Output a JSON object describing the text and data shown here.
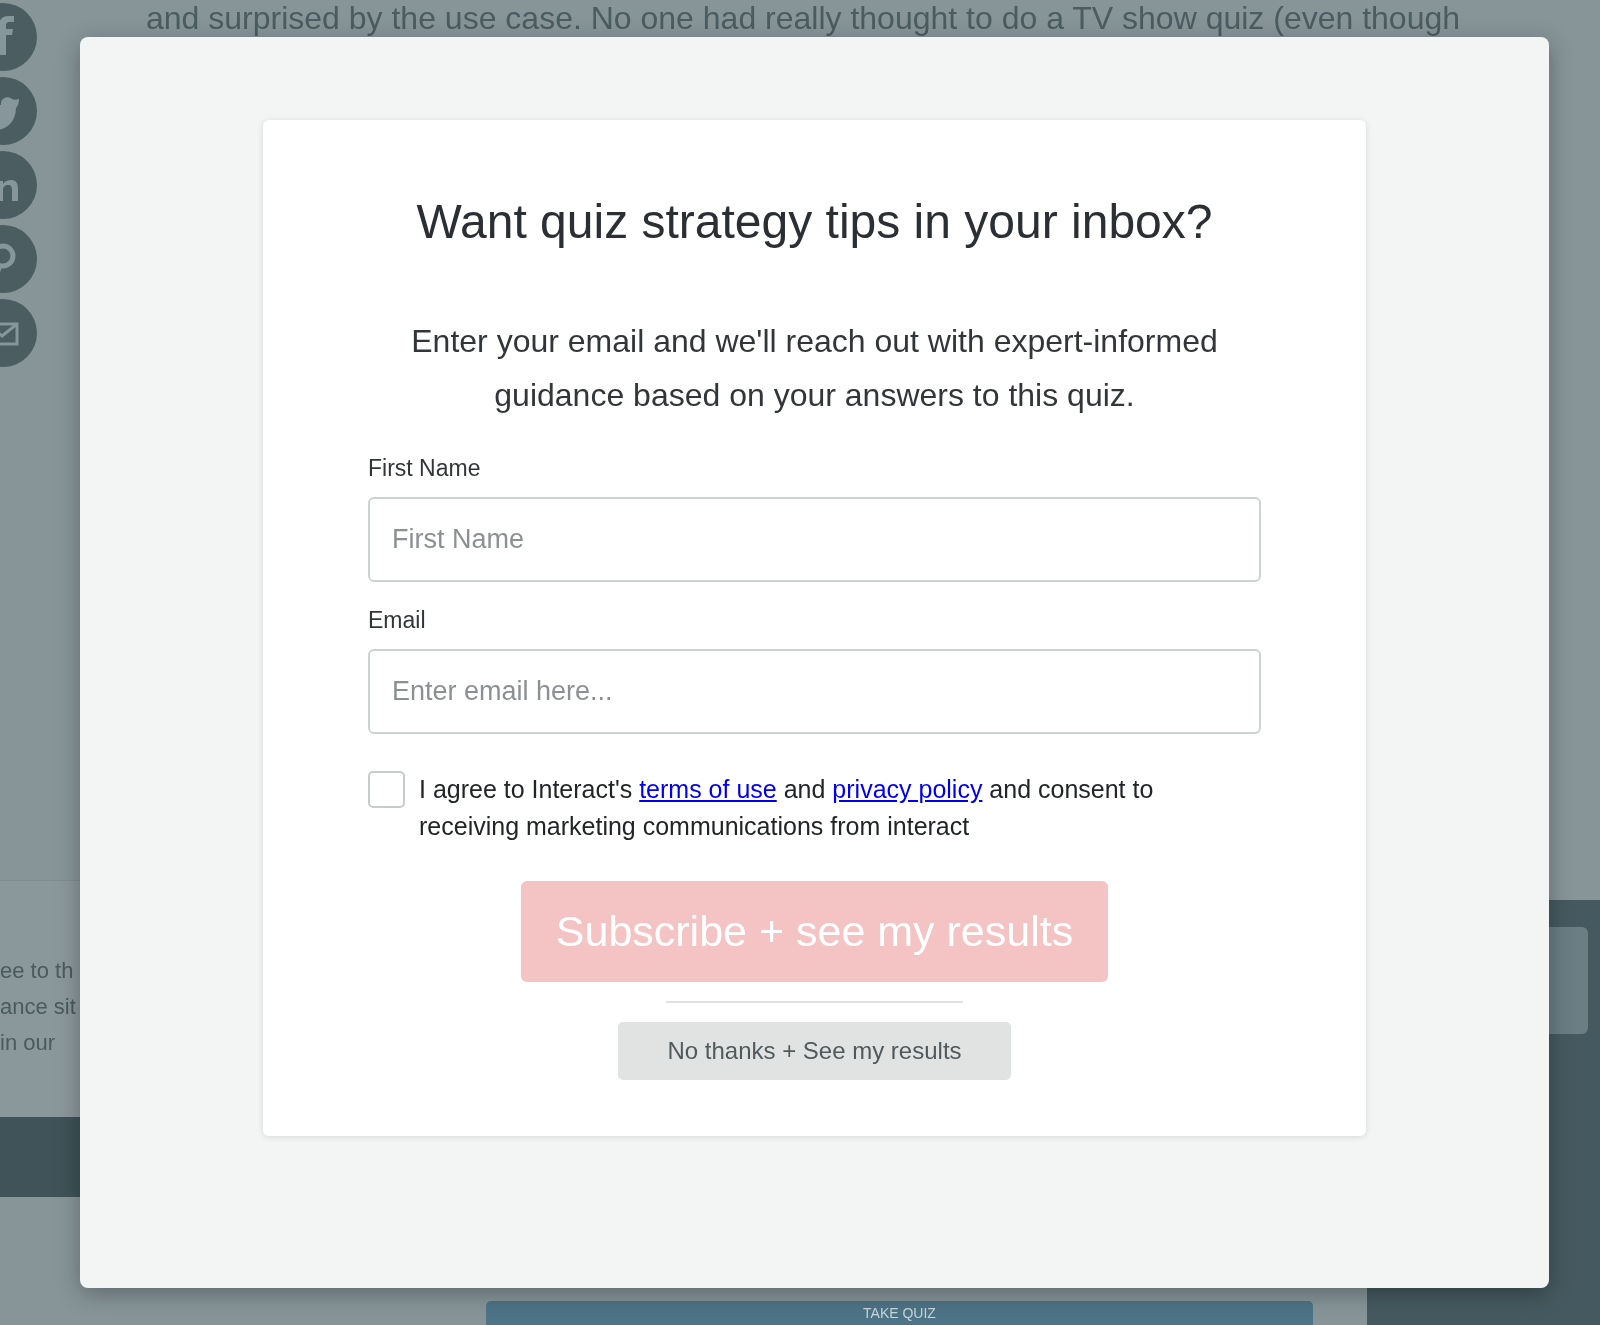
{
  "background_page": {
    "article_text": "and surprised by the use case. No one had really thought to do a TV show quiz (even though",
    "share_icons": [
      {
        "kind": "f"
      },
      {
        "kind": "bird"
      },
      {
        "kind": "in"
      },
      {
        "kind": "p"
      },
      {
        "kind": "envelope"
      }
    ],
    "side_text_lines": [
      "ee to th",
      "ance sit",
      "in our"
    ],
    "quiz_button": {
      "label": "TAKE QUIZ"
    }
  },
  "modal": {
    "title": "Want quiz strategy tips in your inbox?",
    "description": "Enter your email and we'll reach out with expert-informed guidance based on your answers to this quiz.",
    "fields": [
      {
        "label": "First Name",
        "placeholder": "First Name"
      },
      {
        "label": "Email",
        "placeholder": "Enter email here..."
      }
    ],
    "consent": {
      "checked": false,
      "parts": [
        {
          "kind": "text",
          "text": "I agree to Interact's "
        },
        {
          "kind": "link",
          "text": "terms of use"
        },
        {
          "kind": "text",
          "text": " and "
        },
        {
          "kind": "link",
          "text": "privacy policy"
        },
        {
          "kind": "text",
          "text": " and consent to receiving marketing communications from interact"
        }
      ]
    },
    "subscribe_button": {
      "label": "Subscribe + see my results"
    },
    "decline_button": {
      "label": "No thanks + See my results"
    }
  }
}
